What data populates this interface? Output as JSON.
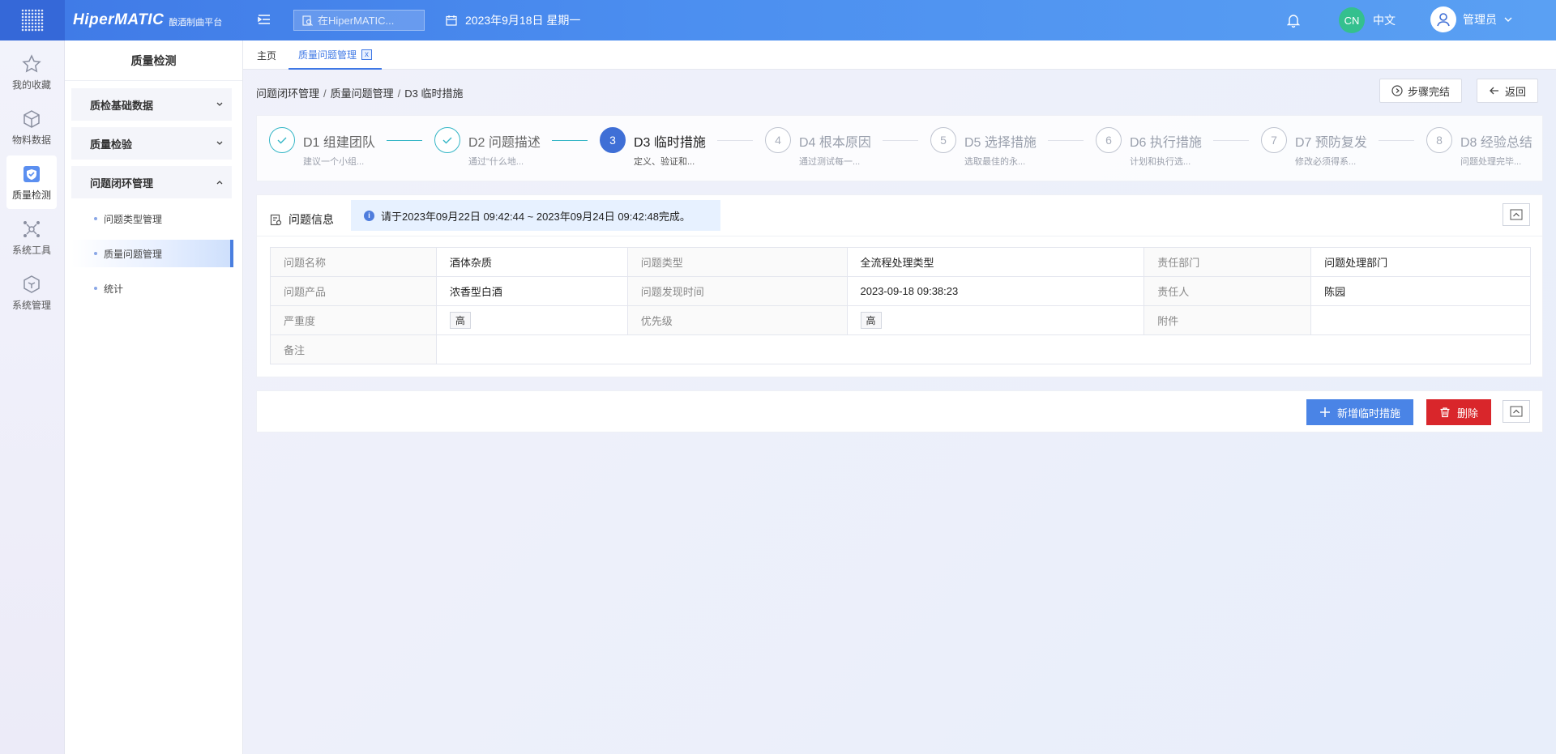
{
  "header": {
    "brand_name": "HiperMATIC",
    "brand_sub": "酿酒制曲平台",
    "search_placeholder": "在HiperMATIC...",
    "date": "2023年9月18日 星期一",
    "lang_badge": "CN",
    "lang_label": "中文",
    "user_name": "管理员"
  },
  "rail": [
    {
      "label": "我的收藏",
      "icon": "star-icon"
    },
    {
      "label": "物料数据",
      "icon": "cube-icon"
    },
    {
      "label": "质量检测",
      "icon": "shield-icon",
      "active": true
    },
    {
      "label": "系统工具",
      "icon": "network-icon"
    },
    {
      "label": "系统管理",
      "icon": "box-icon"
    }
  ],
  "submenu": {
    "title": "质量检测",
    "groups": [
      "质检基础数据",
      "质量检验",
      "问题闭环管理"
    ],
    "leaves": [
      "问题类型管理",
      "质量问题管理",
      "统计"
    ]
  },
  "tabs": {
    "home": "主页",
    "current": "质量问题管理",
    "close": "x"
  },
  "breadcrumb": [
    "问题闭环管理",
    "质量问题管理",
    "D3 临时措施"
  ],
  "sep": "/",
  "actions": {
    "complete": "步骤完结",
    "back": "返回"
  },
  "steps": [
    {
      "num": "1",
      "title": "D1 组建团队",
      "desc": "建议一个小组...",
      "state": "done"
    },
    {
      "num": "2",
      "title": "D2 问题描述",
      "desc": "通过\"什么地...",
      "state": "done"
    },
    {
      "num": "3",
      "title": "D3 临时措施",
      "desc": "定义、验证和...",
      "state": "current"
    },
    {
      "num": "4",
      "title": "D4 根本原因",
      "desc": "通过测试每一...",
      "state": "todo"
    },
    {
      "num": "5",
      "title": "D5 选择措施",
      "desc": "选取最佳的永...",
      "state": "todo"
    },
    {
      "num": "6",
      "title": "D6 执行措施",
      "desc": "计划和执行选...",
      "state": "todo"
    },
    {
      "num": "7",
      "title": "D7 预防复发",
      "desc": "修改必须得系...",
      "state": "todo"
    },
    {
      "num": "8",
      "title": "D8 经验总结",
      "desc": "问题处理完毕...",
      "state": "todo"
    }
  ],
  "info": {
    "title": "问题信息",
    "notice": "请于2023年09月22日 09:42:44 ~ 2023年09月24日 09:42:48完成。",
    "rows": [
      [
        {
          "k": "问题名称",
          "v": "酒体杂质"
        },
        {
          "k": "问题类型",
          "v": "全流程处理类型"
        },
        {
          "k": "责任部门",
          "v": "问题处理部门"
        }
      ],
      [
        {
          "k": "问题产品",
          "v": "浓香型白酒"
        },
        {
          "k": "问题发现时间",
          "v": "2023-09-18 09:38:23"
        },
        {
          "k": "责任人",
          "v": "陈园"
        }
      ],
      [
        {
          "k": "严重度",
          "v": "高"
        },
        {
          "k": "优先级",
          "v": "高"
        },
        {
          "k": "附件",
          "v": ""
        }
      ]
    ],
    "remark_label": "备注",
    "remark_value": ""
  },
  "measures": {
    "add_label": "新增临时措施",
    "delete_label": "删除"
  },
  "colors": {
    "primary": "#4a84e6",
    "danger": "#d9262b",
    "done": "#35b6c6",
    "current": "#3f6fd6"
  }
}
